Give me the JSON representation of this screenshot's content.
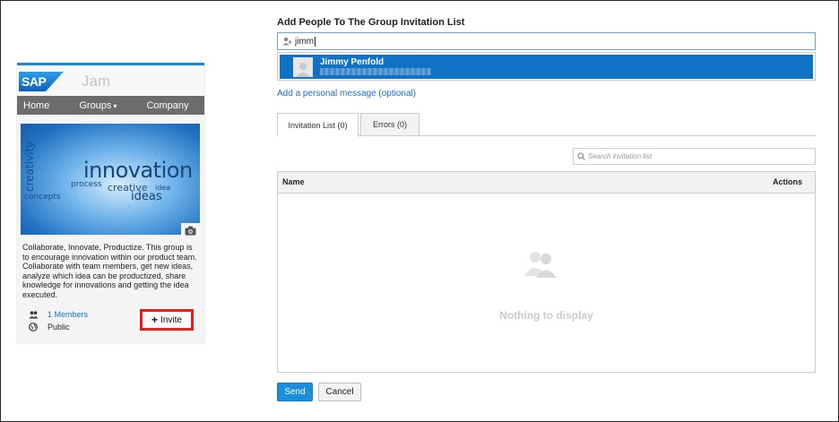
{
  "group_card": {
    "logo_text": "SAP",
    "app_name": "Jam",
    "nav": {
      "home": "Home",
      "groups": "Groups",
      "groups_caret": "▾",
      "company": "Company"
    },
    "banner_words": {
      "innovation": "innovation",
      "creativity": "creativity",
      "creative": "creative",
      "ideas": "ideas",
      "process": "process",
      "concepts": "concepts",
      "idea": "idea"
    },
    "camera_icon": "camera-icon",
    "description": "Collaborate, Innovate, Productize. This group is to encourage innovation within our product team. Collaborate with team members, get new ideas, analyze which idea can be productized, share knowledge for innovations and getting the idea executed.",
    "members_label": "1 Members",
    "members_icon": "members-icon",
    "visibility_label": "Public",
    "visibility_icon": "globe-icon",
    "invite_label": "Invite",
    "invite_icon": "plus-icon"
  },
  "invite_panel": {
    "heading": "Add People To The Group Invitation List",
    "input_value": "jimm",
    "input_icon": "add-person-icon",
    "suggestion": {
      "name": "Jimmy Penfold",
      "avatar_icon": "person-avatar-icon"
    },
    "personal_message_link": "Add a personal message (optional)",
    "tabs": [
      {
        "label": "Invitation List (0)",
        "active": true
      },
      {
        "label": "Errors (0)",
        "active": false
      }
    ],
    "search_placeholder": "Search invitation list",
    "search_icon": "search-icon",
    "table": {
      "columns": [
        "Name",
        "Actions"
      ],
      "empty_icon": "people-icon",
      "empty_text": "Nothing to display"
    },
    "buttons": {
      "send": "Send",
      "cancel": "Cancel"
    }
  },
  "colors": {
    "accent_blue": "#1172c4",
    "link_blue": "#1a6fc4",
    "send_button": "#1b8fdc",
    "highlight_red": "#e3201b",
    "nav_gray": "#6c6c6c"
  }
}
